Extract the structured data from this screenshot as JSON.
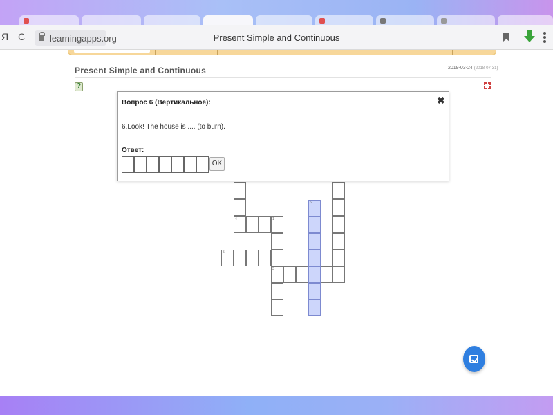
{
  "browser": {
    "nav_label": "Я",
    "reload_glyph": "C",
    "url": "learningapps.org",
    "page_title": "Present Simple and Continuous",
    "icons": [
      "reload-icon",
      "lock-icon",
      "bookmark-icon",
      "download-icon",
      "menu-icon"
    ]
  },
  "app": {
    "title": "Present Simple and Continuous",
    "date": "2019-03-24",
    "date_sub": "(2018-07-31)",
    "help_glyph": "?"
  },
  "crossword": {
    "numbers": {
      "n4": "4",
      "n1": "1",
      "n5": "5",
      "n3": "3",
      "n6": "6"
    }
  },
  "popup": {
    "heading": "Вопрос 6 (Вертикальное):",
    "close": "✖",
    "clue": "6.Look! The house is .... (to burn).",
    "answer_label": "Ответ:",
    "answer_length": 7,
    "ok_label": "OK"
  },
  "colors": {
    "highlight": "#cdd6fb",
    "check_button": "#2f7fe0",
    "header_bar": "#f7d79a"
  }
}
